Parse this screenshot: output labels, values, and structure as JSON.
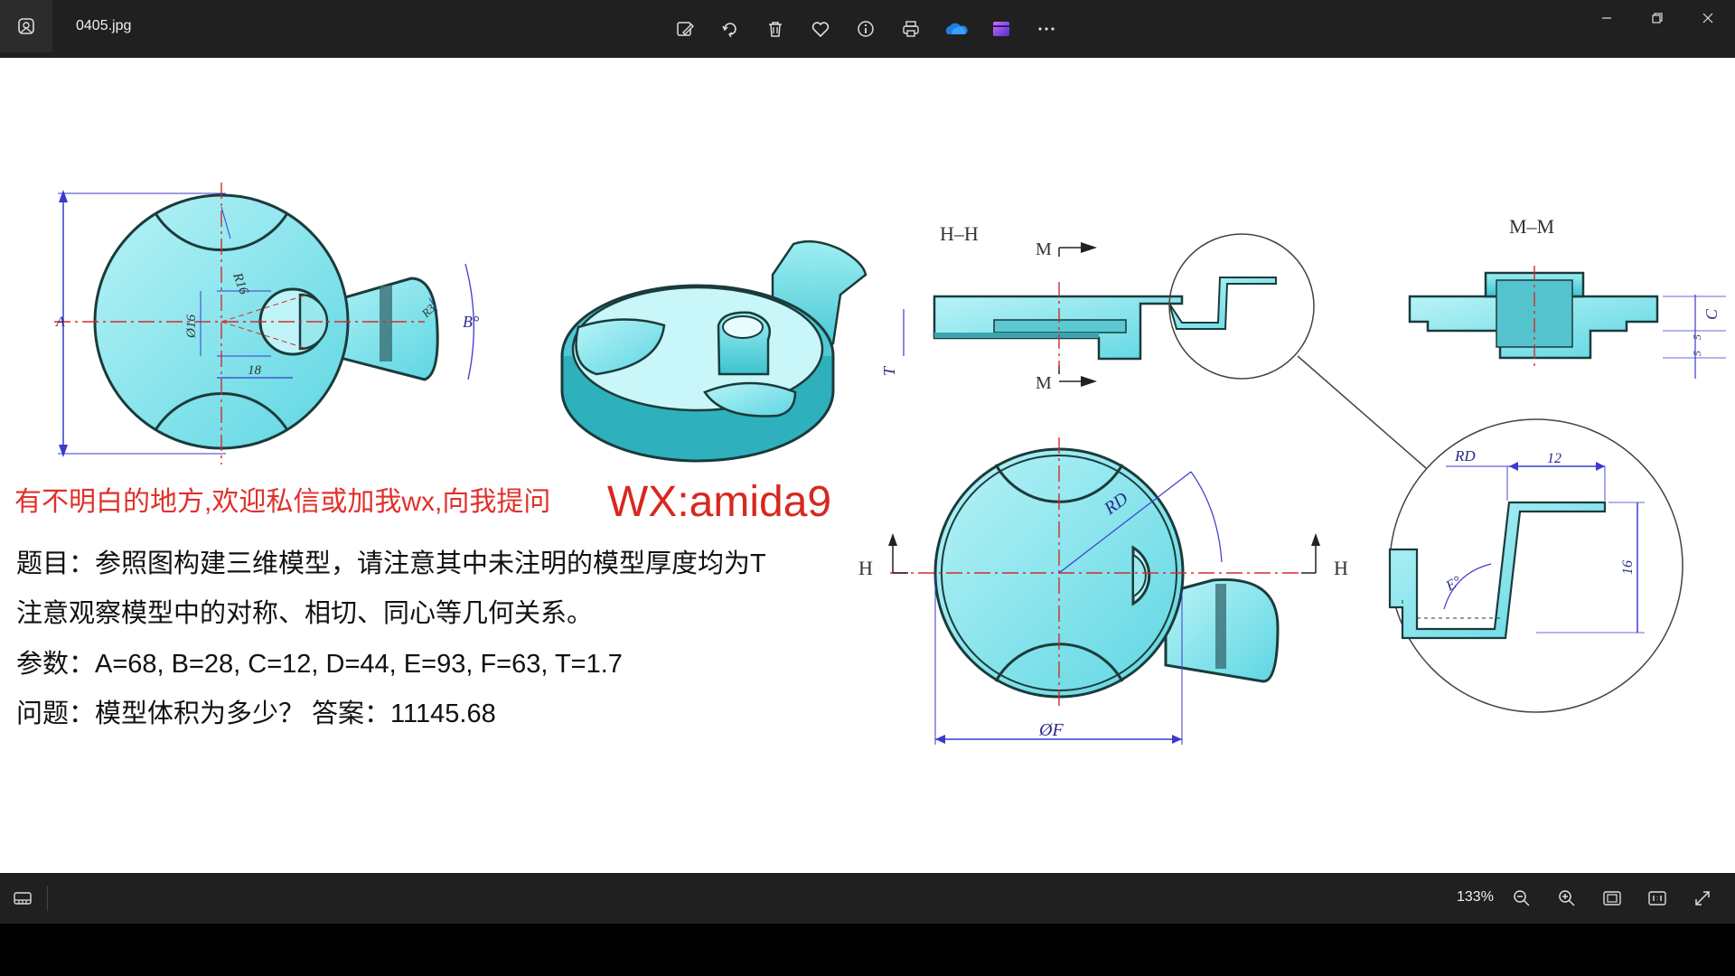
{
  "window": {
    "title": "0405.jpg",
    "toolbar_icons": [
      "edit-image-icon",
      "rotate-icon",
      "delete-icon",
      "favorite-icon",
      "info-icon",
      "print-icon",
      "onedrive-icon",
      "clipchamp-icon",
      "more-icon"
    ],
    "controls": [
      "minimize-icon",
      "restore-icon",
      "close-icon"
    ]
  },
  "image": {
    "note_red": "有不明白的地方,欢迎私信或加我wx,向我提问",
    "wx": "WX:amida9",
    "line1": "题目：参照图构建三维模型，请注意其中未注明的模型厚度均为T",
    "line2": "注意观察模型中的对称、相切、同心等几何关系。",
    "line3": "参数：A=68, B=28, C=12, D=44, E=93, F=63, T=1.7",
    "line4": "问题：模型体积为多少？  答案：11145.68",
    "labels": {
      "hh": "H–H",
      "mm": "M–M",
      "m": "M",
      "h": "H",
      "t": "T",
      "c": "C",
      "a": "A",
      "b": "B°",
      "r16": "R16",
      "r3": "R3",
      "d16": "Ø16",
      "n18": "18",
      "rd": "RD",
      "n12": "12",
      "n16": "16",
      "e": "E°",
      "phif": "ØF",
      "n5a": "5",
      "n5b": "5"
    },
    "colors": {
      "part_fill": "#7fe6ee",
      "red_center": "#d62a2a",
      "dim_blue": "#3a3ad0"
    }
  },
  "status": {
    "zoom": "133%",
    "bottom_icons": [
      "filmstrip-icon",
      "zoom-out-icon",
      "zoom-in-icon",
      "fit-window-icon",
      "actual-size-icon",
      "fullscreen-icon"
    ]
  }
}
